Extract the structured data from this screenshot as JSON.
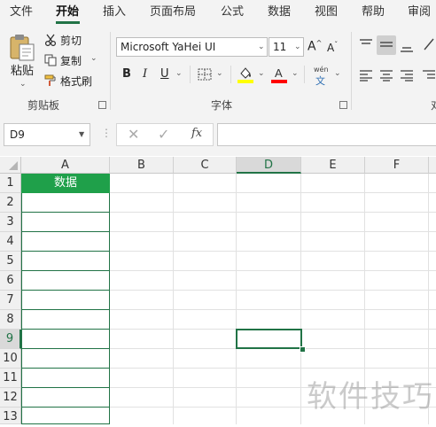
{
  "menu_tabs": [
    {
      "label": "文件",
      "active": false
    },
    {
      "label": "开始",
      "active": true
    },
    {
      "label": "插入",
      "active": false
    },
    {
      "label": "页面布局",
      "active": false
    },
    {
      "label": "公式",
      "active": false
    },
    {
      "label": "数据",
      "active": false
    },
    {
      "label": "视图",
      "active": false
    },
    {
      "label": "帮助",
      "active": false
    },
    {
      "label": "审阅",
      "active": false
    }
  ],
  "ribbon": {
    "clipboard": {
      "paste_label": "粘贴",
      "cut_label": "剪切",
      "copy_label": "复制",
      "format_painter_label": "格式刷",
      "group_label": "剪贴板"
    },
    "font": {
      "font_name": "Microsoft YaHei UI",
      "font_size": "11",
      "bold_label": "B",
      "italic_label": "I",
      "underline_label": "U",
      "phonetic_top": "wén",
      "phonetic_bottom": "文",
      "group_label": "字体",
      "highlight_color": "#ffff00",
      "font_color": "#ff0000"
    },
    "alignment": {
      "group_label_partial": "对"
    }
  },
  "formula_bar": {
    "name_box": "D9",
    "formula": "",
    "fx_label": "fx"
  },
  "sheet": {
    "columns": [
      "A",
      "B",
      "C",
      "D",
      "E",
      "F"
    ],
    "selected_column": "D",
    "rows": [
      "1",
      "2",
      "3",
      "4",
      "5",
      "6",
      "7",
      "8",
      "9",
      "10",
      "11",
      "12",
      "13"
    ],
    "selected_row": "9",
    "a1_value": "数据",
    "accent": "#217346",
    "header_fill": "#1fa04a"
  },
  "watermark": "软件技巧"
}
